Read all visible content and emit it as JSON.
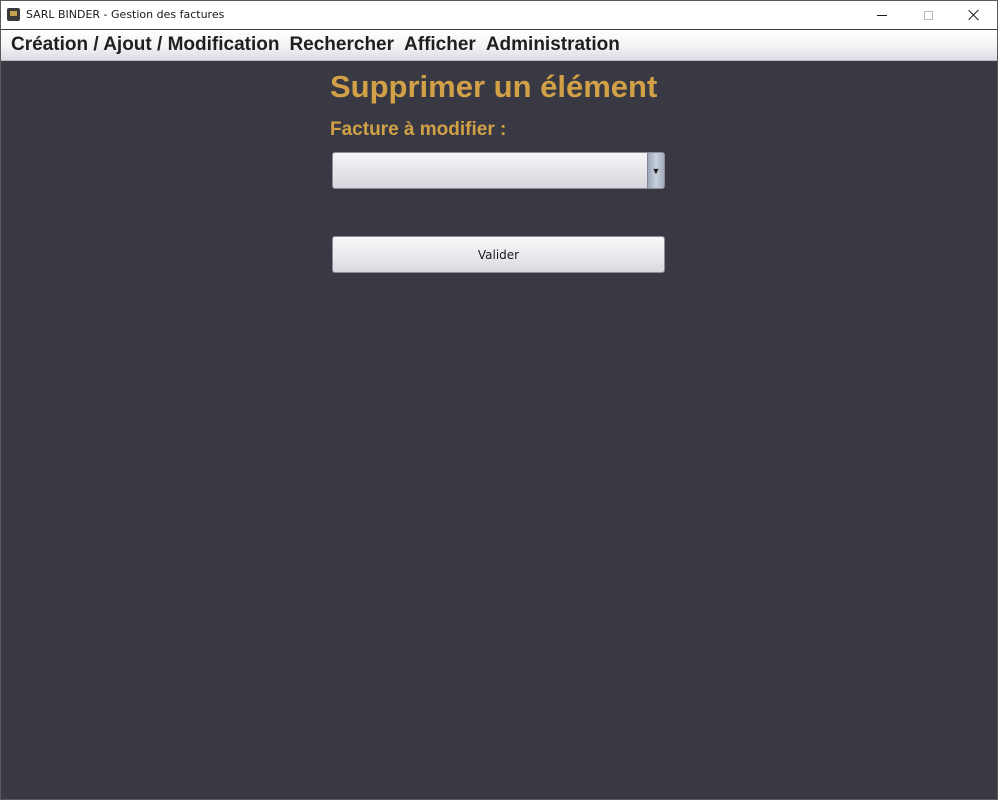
{
  "window": {
    "title": "SARL BINDER - Gestion des factures",
    "icons": {
      "app": "app-icon",
      "minimize": "minimize-icon",
      "maximize": "maximize-icon",
      "close": "close-icon"
    }
  },
  "menubar": {
    "items": [
      {
        "label": "Création / Ajout / Modification"
      },
      {
        "label": "Rechercher"
      },
      {
        "label": "Afficher"
      },
      {
        "label": "Administration"
      }
    ]
  },
  "main": {
    "heading": "Supprimer un élément",
    "field_label": "Facture à modifier :",
    "invoice_select": {
      "selected_value": "",
      "arrow_glyph": "▼",
      "arrow_icon": "chevron-down-icon"
    },
    "submit_label": "Valider"
  },
  "colors": {
    "accent": "#d1a047",
    "background": "#393943",
    "menubar": "#f3f3f6"
  }
}
